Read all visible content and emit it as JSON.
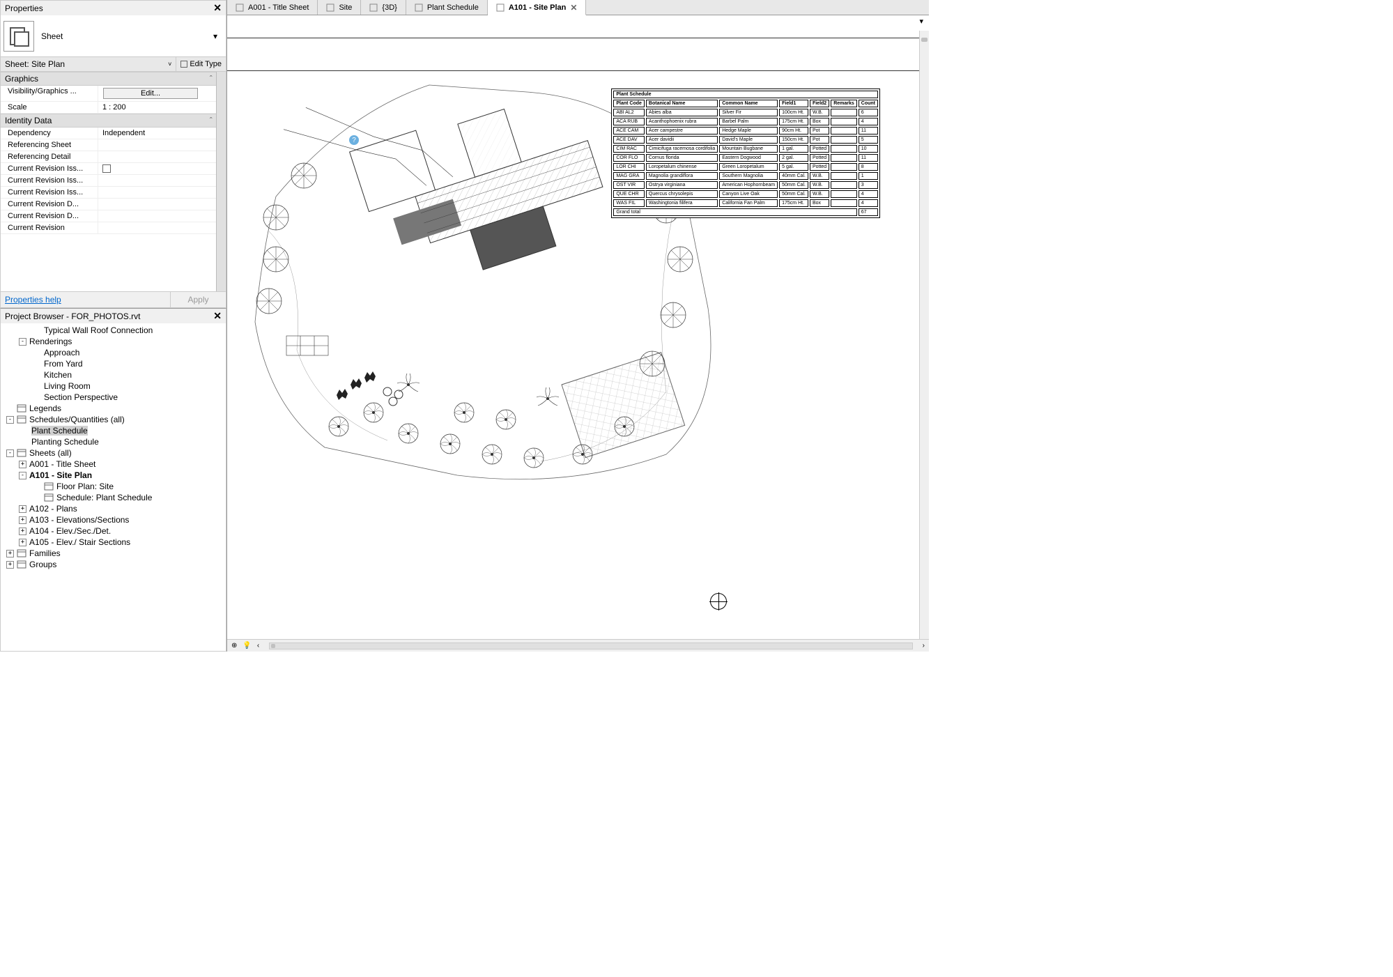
{
  "properties": {
    "panel_title": "Properties",
    "type_label": "Sheet",
    "instance_label": "Sheet: Site Plan",
    "edit_type": "Edit Type",
    "groups": [
      {
        "name": "Graphics",
        "rows": [
          {
            "name": "Visibility/Graphics ...",
            "kind": "button",
            "value": "Edit..."
          },
          {
            "name": "Scale",
            "kind": "text",
            "value": "1 : 200"
          }
        ]
      },
      {
        "name": "Identity Data",
        "rows": [
          {
            "name": "Dependency",
            "kind": "text",
            "value": "Independent"
          },
          {
            "name": "Referencing Sheet",
            "kind": "text",
            "value": ""
          },
          {
            "name": "Referencing Detail",
            "kind": "text",
            "value": ""
          },
          {
            "name": "Current Revision Iss...",
            "kind": "check",
            "value": ""
          },
          {
            "name": "Current Revision Iss...",
            "kind": "text",
            "value": ""
          },
          {
            "name": "Current Revision Iss...",
            "kind": "text",
            "value": ""
          },
          {
            "name": "Current Revision D...",
            "kind": "text",
            "value": ""
          },
          {
            "name": "Current Revision D...",
            "kind": "text",
            "value": ""
          },
          {
            "name": "Current Revision",
            "kind": "text",
            "value": ""
          }
        ]
      }
    ],
    "help_label": "Properties help",
    "apply_label": "Apply"
  },
  "browser": {
    "title": "Project Browser - FOR_PHOTOS.rvt",
    "items": [
      {
        "indent": 3,
        "toggle": "",
        "icon": "",
        "label": "Typical Wall Roof Connection"
      },
      {
        "indent": 1,
        "toggle": "-",
        "icon": "",
        "label": "Renderings"
      },
      {
        "indent": 3,
        "toggle": "",
        "icon": "",
        "label": "Approach"
      },
      {
        "indent": 3,
        "toggle": "",
        "icon": "",
        "label": "From Yard"
      },
      {
        "indent": 3,
        "toggle": "",
        "icon": "",
        "label": "Kitchen"
      },
      {
        "indent": 3,
        "toggle": "",
        "icon": "",
        "label": "Living Room"
      },
      {
        "indent": 3,
        "toggle": "",
        "icon": "",
        "label": "Section Perspective"
      },
      {
        "indent": 0,
        "toggle": " ",
        "icon": "legend",
        "label": "Legends"
      },
      {
        "indent": 0,
        "toggle": "-",
        "icon": "sched",
        "label": "Schedules/Quantities (all)"
      },
      {
        "indent": 2,
        "toggle": "",
        "icon": "",
        "label": "Plant Schedule",
        "selected": true
      },
      {
        "indent": 2,
        "toggle": "",
        "icon": "",
        "label": "Planting Schedule"
      },
      {
        "indent": 0,
        "toggle": "-",
        "icon": "sheet",
        "label": "Sheets (all)"
      },
      {
        "indent": 1,
        "toggle": "+",
        "icon": "",
        "label": "A001 - Title Sheet"
      },
      {
        "indent": 1,
        "toggle": "-",
        "icon": "",
        "label": "A101 - Site Plan",
        "bold": true
      },
      {
        "indent": 3,
        "toggle": "",
        "icon": "plan",
        "label": "Floor Plan: Site"
      },
      {
        "indent": 3,
        "toggle": "",
        "icon": "sched",
        "label": "Schedule: Plant Schedule"
      },
      {
        "indent": 1,
        "toggle": "+",
        "icon": "",
        "label": "A102 - Plans"
      },
      {
        "indent": 1,
        "toggle": "+",
        "icon": "",
        "label": "A103 - Elevations/Sections"
      },
      {
        "indent": 1,
        "toggle": "+",
        "icon": "",
        "label": "A104 - Elev./Sec./Det."
      },
      {
        "indent": 1,
        "toggle": "+",
        "icon": "",
        "label": "A105 - Elev./ Stair Sections"
      },
      {
        "indent": 0,
        "toggle": "+",
        "icon": "fam",
        "label": "Families"
      },
      {
        "indent": 0,
        "toggle": "+",
        "icon": "grp",
        "label": "Groups"
      }
    ]
  },
  "tabs": [
    {
      "icon": "sheet",
      "label": "A001 - Title Sheet",
      "active": false,
      "closable": false
    },
    {
      "icon": "plan",
      "label": "Site",
      "active": false,
      "closable": false
    },
    {
      "icon": "3d",
      "label": "{3D}",
      "active": false,
      "closable": false
    },
    {
      "icon": "sched",
      "label": "Plant Schedule",
      "active": false,
      "closable": false
    },
    {
      "icon": "sheet",
      "label": "A101 - Site Plan",
      "active": true,
      "closable": true
    }
  ],
  "schedule": {
    "title": "Plant Schedule",
    "headers": [
      "Plant Code",
      "Botanical Name",
      "Common Name",
      "Field1",
      "Field2",
      "Remarks",
      "Count"
    ],
    "rows": [
      [
        "ABI AL2",
        "Abies alba",
        "Silver Fir",
        "100cm Ht.",
        "W.B.",
        "",
        "6"
      ],
      [
        "ACA RUB",
        "Acanthophoenix rubra",
        "Barbel Palm",
        "175cm Ht.",
        "Box",
        "",
        "4"
      ],
      [
        "ACE CAM",
        "Acer campestre",
        "Hedge Maple",
        "90cm Ht.",
        "Pot",
        "",
        "11"
      ],
      [
        "ACE DAV",
        "Acer davidii",
        "David's Maple",
        "150cm Ht.",
        "Pot",
        "",
        "5"
      ],
      [
        "CIM RAC",
        "Cimicifuga racemosa cordifolia",
        "Mountain Bugbane",
        "1 gal.",
        "Potted",
        "",
        "10"
      ],
      [
        "COR FLO",
        "Cornus florida",
        "Eastern Dogwood",
        "2 gal.",
        "Potted",
        "",
        "11"
      ],
      [
        "LOR CHI",
        "Loropetalum chinense",
        "Green Loropetalum",
        "5 gal.",
        "Potted",
        "",
        "8"
      ],
      [
        "MAG GRA",
        "Magnolia grandiflora",
        "Southern Magnolia",
        "40mm Cal.",
        "W.B.",
        "",
        "1"
      ],
      [
        "OST VIR",
        "Ostrya virginiana",
        "American Hophornbeam",
        "50mm Cal.",
        "W.B.",
        "",
        "3"
      ],
      [
        "QUE CHR",
        "Quercus chrysolepis",
        "Canyon Live Oak",
        "50mm Cal.",
        "W.B.",
        "",
        "4"
      ],
      [
        "WAS FIL",
        "Washingtonia filifera",
        "California Fan Palm",
        "175cm Ht.",
        "Box",
        "",
        "4"
      ]
    ],
    "footer_label": "Grand total",
    "footer_value": "67"
  }
}
